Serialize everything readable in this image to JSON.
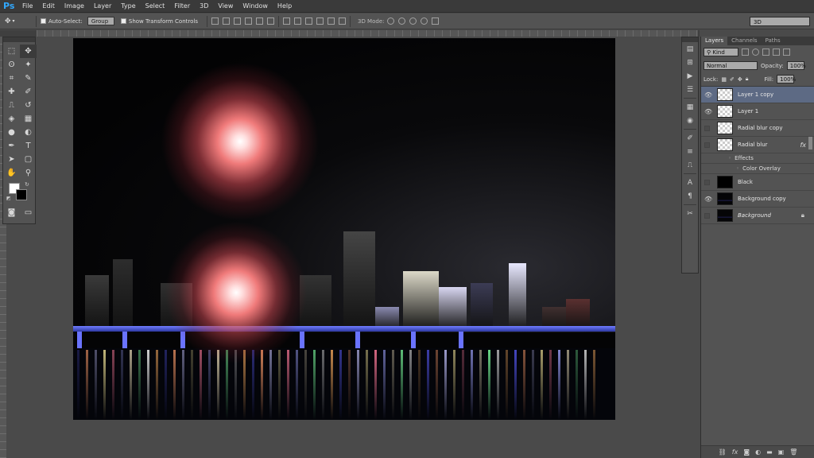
{
  "app": {
    "logo": "Ps"
  },
  "menu": [
    "File",
    "Edit",
    "Image",
    "Layer",
    "Type",
    "Select",
    "Filter",
    "3D",
    "View",
    "Window",
    "Help"
  ],
  "options": {
    "auto_select_label": "Auto-Select:",
    "auto_select_value": "Group",
    "transform_label": "Show Transform Controls",
    "mode_3d_label": "3D Mode:",
    "workspace": "3D"
  },
  "tools": [
    {
      "icon": "⬚",
      "name": "marquee-tool-icon"
    },
    {
      "icon": "✥",
      "name": "move-tool-icon",
      "active": true
    },
    {
      "icon": "ʘ",
      "name": "lasso-tool-icon"
    },
    {
      "icon": "✦",
      "name": "magic-wand-tool-icon"
    },
    {
      "icon": "⌗",
      "name": "crop-tool-icon"
    },
    {
      "icon": "✎",
      "name": "eyedropper-tool-icon"
    },
    {
      "icon": "✚",
      "name": "healing-brush-tool-icon"
    },
    {
      "icon": "✐",
      "name": "brush-tool-icon"
    },
    {
      "icon": "⎍",
      "name": "clone-stamp-tool-icon"
    },
    {
      "icon": "↺",
      "name": "history-brush-tool-icon"
    },
    {
      "icon": "◈",
      "name": "eraser-tool-icon"
    },
    {
      "icon": "▦",
      "name": "gradient-tool-icon"
    },
    {
      "icon": "●",
      "name": "blur-tool-icon"
    },
    {
      "icon": "◐",
      "name": "dodge-tool-icon"
    },
    {
      "icon": "✒",
      "name": "pen-tool-icon"
    },
    {
      "icon": "T",
      "name": "type-tool-icon"
    },
    {
      "icon": "➤",
      "name": "path-selection-tool-icon"
    },
    {
      "icon": "▢",
      "name": "shape-tool-icon"
    },
    {
      "icon": "✋",
      "name": "hand-tool-icon"
    },
    {
      "icon": "⚲",
      "name": "zoom-tool-icon"
    }
  ],
  "layers_panel": {
    "tabs": [
      "Layers",
      "Channels",
      "Paths"
    ],
    "kind": "Kind",
    "blend_mode": "Normal",
    "opacity_label": "Opacity:",
    "opacity_value": "100%",
    "lock_label": "Lock:",
    "fill_label": "Fill:",
    "fill_value": "100%",
    "layers": [
      {
        "name": "Layer 1 copy",
        "visible": true,
        "thumb": "checker",
        "selected": true
      },
      {
        "name": "Layer 1",
        "visible": true,
        "thumb": "checker"
      },
      {
        "name": "Radial blur copy",
        "visible": false,
        "thumb": "checker"
      },
      {
        "name": "Radial blur",
        "visible": false,
        "thumb": "checker",
        "fx": "fx"
      },
      {
        "name": "Black",
        "visible": false,
        "thumb": "black"
      },
      {
        "name": "Background copy",
        "visible": true,
        "thumb": "photo"
      },
      {
        "name": "Background",
        "visible": false,
        "thumb": "photo",
        "italic": true,
        "locked": true
      }
    ],
    "effects_label": "Effects",
    "effect_item": "Color Overlay"
  }
}
